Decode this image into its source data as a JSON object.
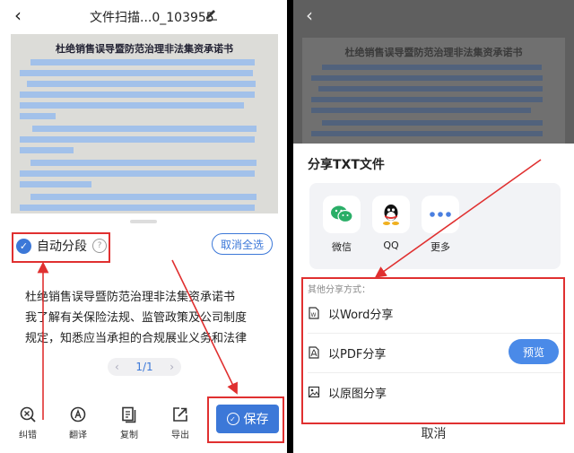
{
  "left": {
    "title": "文件扫描...0_103955",
    "document": {
      "title": "杜绝销售误导暨防范治理非法集资承诺书"
    },
    "auto_paragraph_label": "自动分段",
    "help_symbol": "?",
    "deselect_all_label": "取消全选",
    "text_lines": [
      "杜绝销售误导暨防范治理非法集资承诺书",
      "我了解有关保险法规、监管政策及公司制度",
      "规定，知悉应当承担的合规展业义务和法律"
    ],
    "pager": "1/1",
    "toolbar": [
      {
        "label": "纠错",
        "icon": "correct-icon"
      },
      {
        "label": "翻译",
        "icon": "translate-icon"
      },
      {
        "label": "复制",
        "icon": "copy-icon"
      },
      {
        "label": "导出",
        "icon": "export-icon"
      }
    ],
    "save_label": "保存"
  },
  "right": {
    "dim_document_title": "杜绝销售误导暨防范治理非法集资承诺书",
    "share_title": "分享TXT文件",
    "apps": [
      {
        "label": "微信",
        "icon": "wechat-icon"
      },
      {
        "label": "QQ",
        "icon": "qq-icon"
      },
      {
        "label": "更多",
        "icon": "more-icon"
      }
    ],
    "other_share_title": "其他分享方式：",
    "options": [
      {
        "label": "以Word分享",
        "icon": "word-icon"
      },
      {
        "label": "以PDF分享",
        "icon": "pdf-icon"
      },
      {
        "label": "以原图分享",
        "icon": "image-icon"
      }
    ],
    "preview_label": "预览",
    "cancel_label": "取消"
  },
  "colors": {
    "accent": "#3c78d8",
    "annotation": "#e03030",
    "wechat": "#2aae67"
  }
}
